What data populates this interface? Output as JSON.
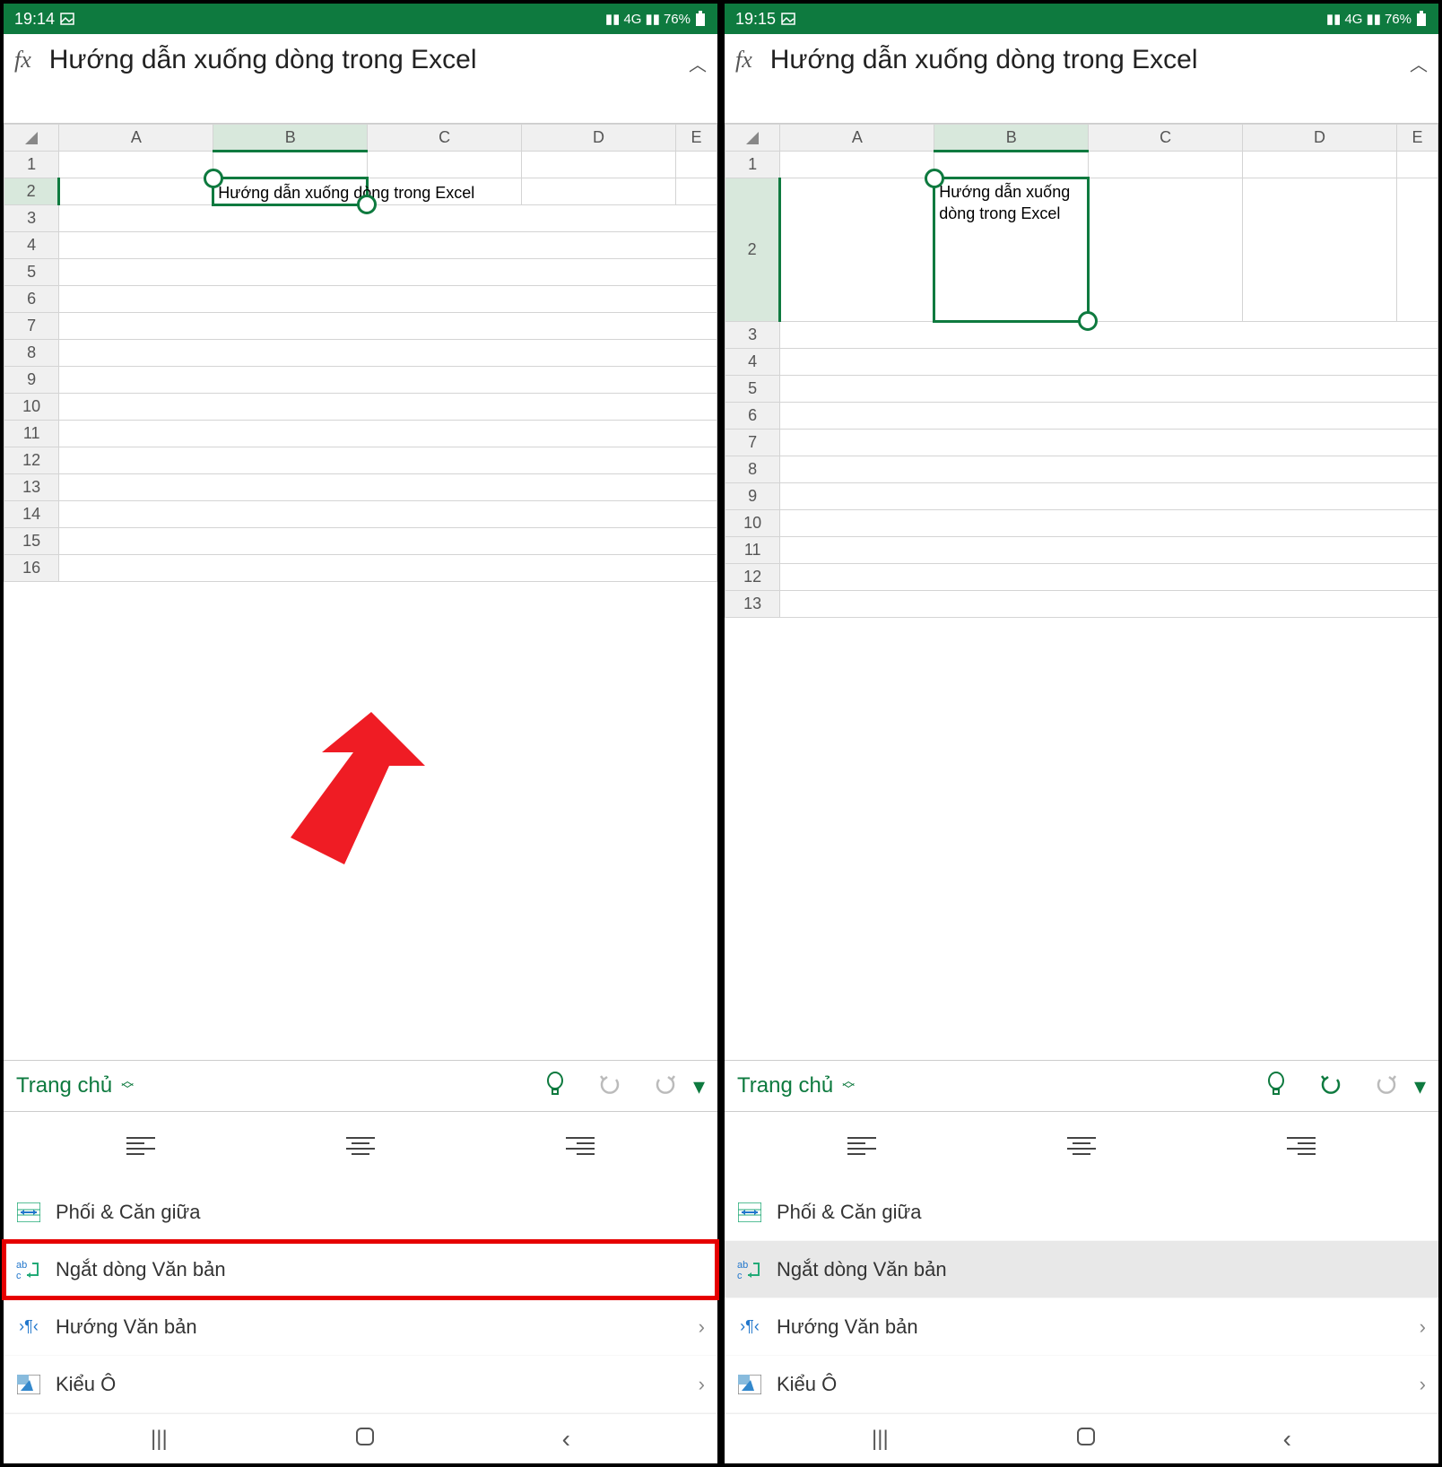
{
  "left": {
    "status": {
      "time": "19:14",
      "battery": "76%",
      "net": "4G"
    },
    "formula": "Hướng dẫn xuống dòng trong Excel",
    "columns": [
      "A",
      "B",
      "C",
      "D",
      "E"
    ],
    "rows_before": [
      "1"
    ],
    "rows_after": [
      "3",
      "4",
      "5",
      "6",
      "7",
      "8",
      "9",
      "10",
      "11",
      "12",
      "13",
      "14",
      "15",
      "16"
    ],
    "sel_row": "2",
    "cell_b2": "Hướng dẫn xuống dòng trong Excel",
    "ribbon_tab": "Trang chủ",
    "tools": {
      "merge": "Phối & Căn giữa",
      "wrap": "Ngắt dòng Văn bản",
      "direction": "Hướng Văn bản",
      "cellstyle": "Kiểu Ô"
    }
  },
  "right": {
    "status": {
      "time": "19:15",
      "battery": "76%",
      "net": "4G"
    },
    "formula": "Hướng dẫn xuống dòng trong Excel",
    "columns": [
      "A",
      "B",
      "C",
      "D",
      "E"
    ],
    "rows_before": [
      "1"
    ],
    "rows_after": [
      "3",
      "4",
      "5",
      "6",
      "7",
      "8",
      "9",
      "10",
      "11",
      "12",
      "13"
    ],
    "sel_row": "2",
    "cell_b2": "Hướng dẫn xuống dòng trong Excel",
    "ribbon_tab": "Trang chủ",
    "tools": {
      "merge": "Phối & Căn giữa",
      "wrap": "Ngắt dòng Văn bản",
      "direction": "Hướng Văn bản",
      "cellstyle": "Kiểu Ô"
    }
  }
}
